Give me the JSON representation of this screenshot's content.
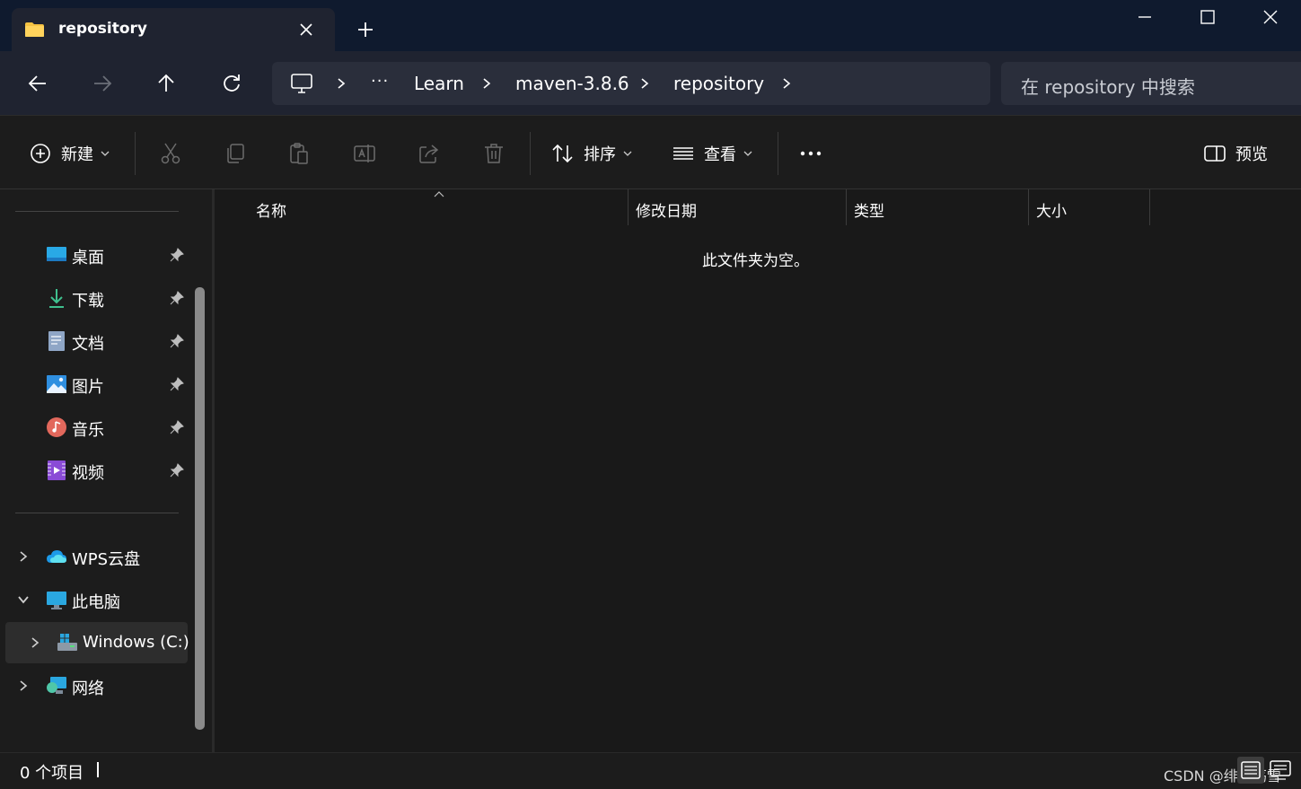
{
  "tab": {
    "title": "repository"
  },
  "address": {
    "more": "···",
    "crumbs": [
      "Learn",
      "maven-3.8.6",
      "repository"
    ]
  },
  "search": {
    "placeholder": "在 repository 中搜索"
  },
  "toolbar": {
    "new_label": "新建",
    "sort_label": "排序",
    "view_label": "查看",
    "preview_label": "预览"
  },
  "sidebar": {
    "quick_access": [
      {
        "label": "桌面"
      },
      {
        "label": "下载"
      },
      {
        "label": "文档"
      },
      {
        "label": "图片"
      },
      {
        "label": "音乐"
      },
      {
        "label": "视频"
      }
    ],
    "tree": [
      {
        "label": "WPS云盘"
      },
      {
        "label": "此电脑"
      },
      {
        "label": "Windows (C:)"
      },
      {
        "label": "网络"
      }
    ]
  },
  "columns": [
    "名称",
    "修改日期",
    "类型",
    "大小"
  ],
  "content": {
    "empty_message": "此文件夹为空。"
  },
  "status": {
    "item_count": "0 个项目"
  },
  "watermark": "CSDN @绯樱殇雪",
  "colors": {
    "accent": "#4cc2ff",
    "folder": "#f5c242",
    "window_bg": "#1c1c1c",
    "address_bg": "#2a2e3b"
  }
}
